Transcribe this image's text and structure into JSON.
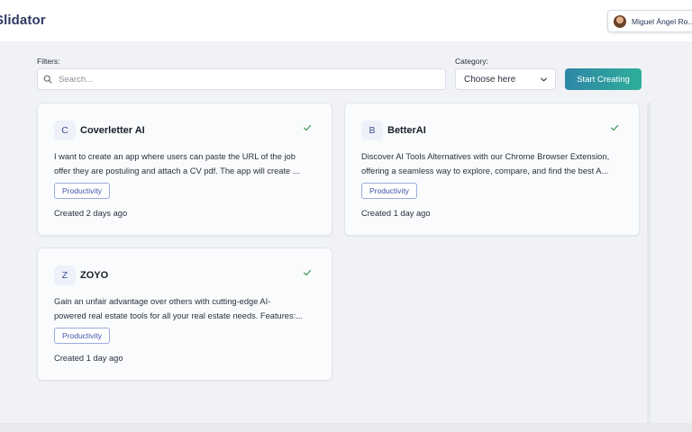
{
  "header": {
    "brand": "Slidator",
    "user_name": "Miguel Ángel Ro..."
  },
  "filters": {
    "label": "Filters:",
    "search_placeholder": "Search...",
    "category_label": "Category:",
    "category_value": "Choose here",
    "start_button": "Start Creating"
  },
  "cards": [
    {
      "letter": "C",
      "title": "Coverletter AI",
      "desc_line1": "I want to create an app where users can paste the URL of the job",
      "desc_line2": "offer they are postuling and attach a CV pdf. The app will create ...",
      "badge": "Productivity",
      "created": "Created 2 days ago"
    },
    {
      "letter": "B",
      "title": "BetterAI",
      "desc_line1": "Discover AI Tools Alternatives with our Chrome Browser Extension,",
      "desc_line2": "offering a seamless way to explore, compare, and find the best A...",
      "badge": "Productivity",
      "created": "Created 1 day ago"
    },
    {
      "letter": "Z",
      "title": "ZOYO",
      "desc_line1": "Gain an unfair advantage over others with cutting-edge AI-",
      "desc_line2": "powered real estate tools for all your real estate needs. Features:...",
      "badge": "Productivity",
      "created": "Created 1 day ago"
    }
  ],
  "colors": {
    "accent_start": "#2e86a5",
    "accent_end": "#2fae9a",
    "badge": "#3f55a8",
    "check": "#3a9a5b"
  }
}
